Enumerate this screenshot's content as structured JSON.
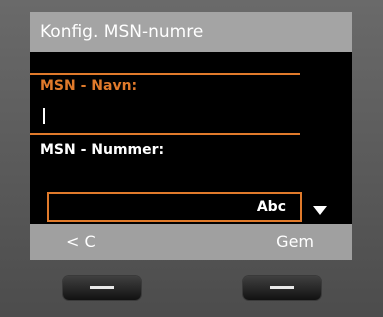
{
  "screen": {
    "title": "Konfig. MSN-numre",
    "fields": [
      {
        "label": "MSN - Navn:",
        "value": ""
      },
      {
        "label": "MSN - Nummer:",
        "value": ""
      }
    ],
    "input_mode": "Abc"
  },
  "softkeys": {
    "left": "< C",
    "right": "Gem"
  },
  "colors": {
    "accent": "#e07a2b",
    "titlebar": "#a4a4a4",
    "screen_bg": "#000000"
  },
  "icons": {
    "scroll_indicator": "down-arrow-icon"
  }
}
